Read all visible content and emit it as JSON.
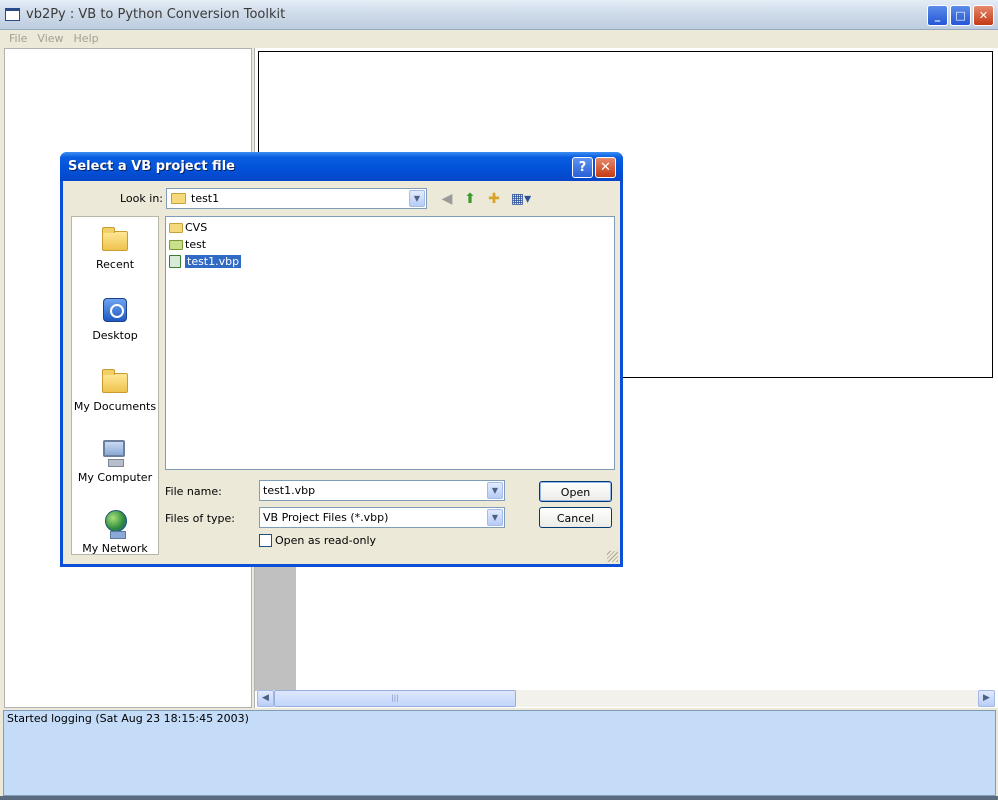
{
  "app": {
    "title": "vb2Py : VB to Python Conversion Toolkit",
    "menu": [
      "File",
      "View",
      "Help"
    ],
    "log_lines": [
      "Started logging (Sat Aug 23 18:15:45 2003)"
    ]
  },
  "dialog": {
    "title": "Select a VB project file",
    "look_in_label": "Look in:",
    "look_in_value": "test1",
    "places": [
      {
        "label": "Recent",
        "icon": "recent-folder-icon"
      },
      {
        "label": "Desktop",
        "icon": "desktop-icon"
      },
      {
        "label": "My Documents",
        "icon": "my-documents-icon"
      },
      {
        "label": "My Computer",
        "icon": "my-computer-icon"
      },
      {
        "label": "My Network",
        "icon": "my-network-icon"
      }
    ],
    "files": [
      {
        "name": "CVS",
        "type": "folder"
      },
      {
        "name": "test",
        "type": "folder"
      },
      {
        "name": "test1.vbp",
        "type": "vbp",
        "selected": true
      }
    ],
    "file_name_label": "File name:",
    "file_name_value": "test1.vbp",
    "files_of_type_label": "Files of type:",
    "files_of_type_value": "VB Project Files (*.vbp)",
    "read_only_label": "Open as read-only",
    "open_label": "Open",
    "cancel_label": "Cancel"
  },
  "colors": {
    "dialog_title_blue": "#0251d8",
    "selection_blue": "#316ac5",
    "log_background": "#c4dcf7"
  }
}
